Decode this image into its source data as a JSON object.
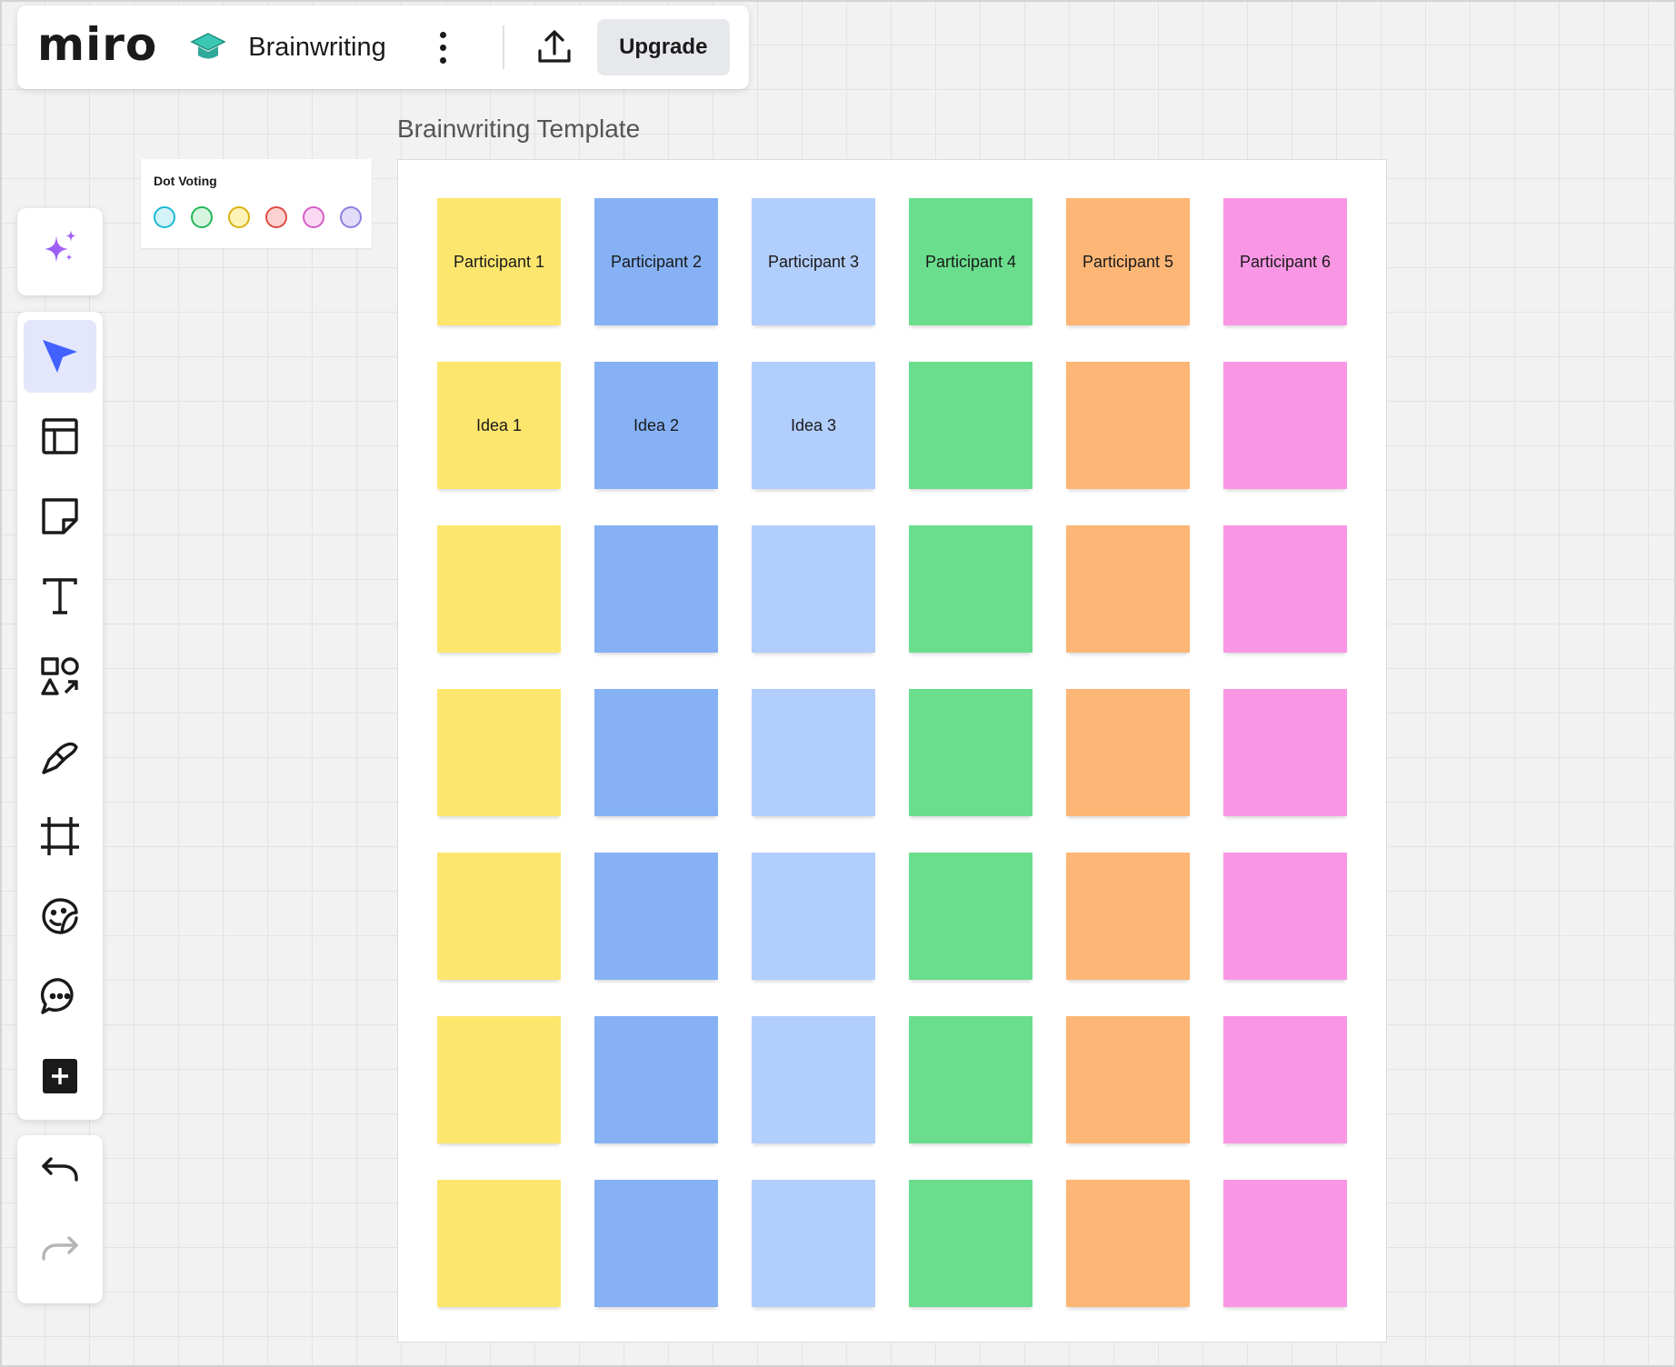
{
  "app": {
    "logo": "miro",
    "board_title": "Brainwriting",
    "upgrade_label": "Upgrade"
  },
  "canvas": {
    "title": "Brainwriting Template"
  },
  "dot_voting": {
    "title": "Dot Voting",
    "dots": [
      {
        "fill": "#d3f3f8",
        "border": "#1cb8d2"
      },
      {
        "fill": "#d6f5df",
        "border": "#26b65a"
      },
      {
        "fill": "#fdf3b9",
        "border": "#d9b20f"
      },
      {
        "fill": "#fcd2d0",
        "border": "#e04b46"
      },
      {
        "fill": "#fbd9f3",
        "border": "#d75cc9"
      },
      {
        "fill": "#e2dcf8",
        "border": "#8f7fe0"
      }
    ]
  },
  "colors": {
    "accent": "#4262ff",
    "yellow": "#fde66e",
    "blue": "#86b2f5",
    "lightblue": "#b2cefc",
    "green": "#6ade8d",
    "orange": "#fdb676",
    "pink": "#fa97e5"
  },
  "tools": [
    {
      "name": "select-tool",
      "icon": "cursor-arrow-icon",
      "active": true
    },
    {
      "name": "templates-tool",
      "icon": "layout-icon"
    },
    {
      "name": "sticky-note-tool",
      "icon": "sticky-note-icon"
    },
    {
      "name": "text-tool",
      "icon": "text-icon"
    },
    {
      "name": "shapes-tool",
      "icon": "shapes-icon"
    },
    {
      "name": "pen-tool",
      "icon": "pen-icon"
    },
    {
      "name": "frame-tool",
      "icon": "frame-icon"
    },
    {
      "name": "stickers-tool",
      "icon": "sticker-icon"
    },
    {
      "name": "comment-tool",
      "icon": "comment-icon"
    },
    {
      "name": "more-apps-tool",
      "icon": "plus-square-icon"
    }
  ],
  "columns": [
    "yellow",
    "blue",
    "lightblue",
    "green",
    "orange",
    "pink"
  ],
  "stickies": [
    [
      "Participant 1",
      "Participant 2",
      "Participant 3",
      "Participant 4",
      "Participant 5",
      "Participant 6"
    ],
    [
      "Idea 1",
      "Idea 2",
      "Idea 3",
      "",
      "",
      ""
    ],
    [
      "",
      "",
      "",
      "",
      "",
      ""
    ],
    [
      "",
      "",
      "",
      "",
      "",
      ""
    ],
    [
      "",
      "",
      "",
      "",
      "",
      ""
    ],
    [
      "",
      "",
      "",
      "",
      "",
      ""
    ],
    [
      "",
      "",
      "",
      "",
      "",
      ""
    ]
  ]
}
